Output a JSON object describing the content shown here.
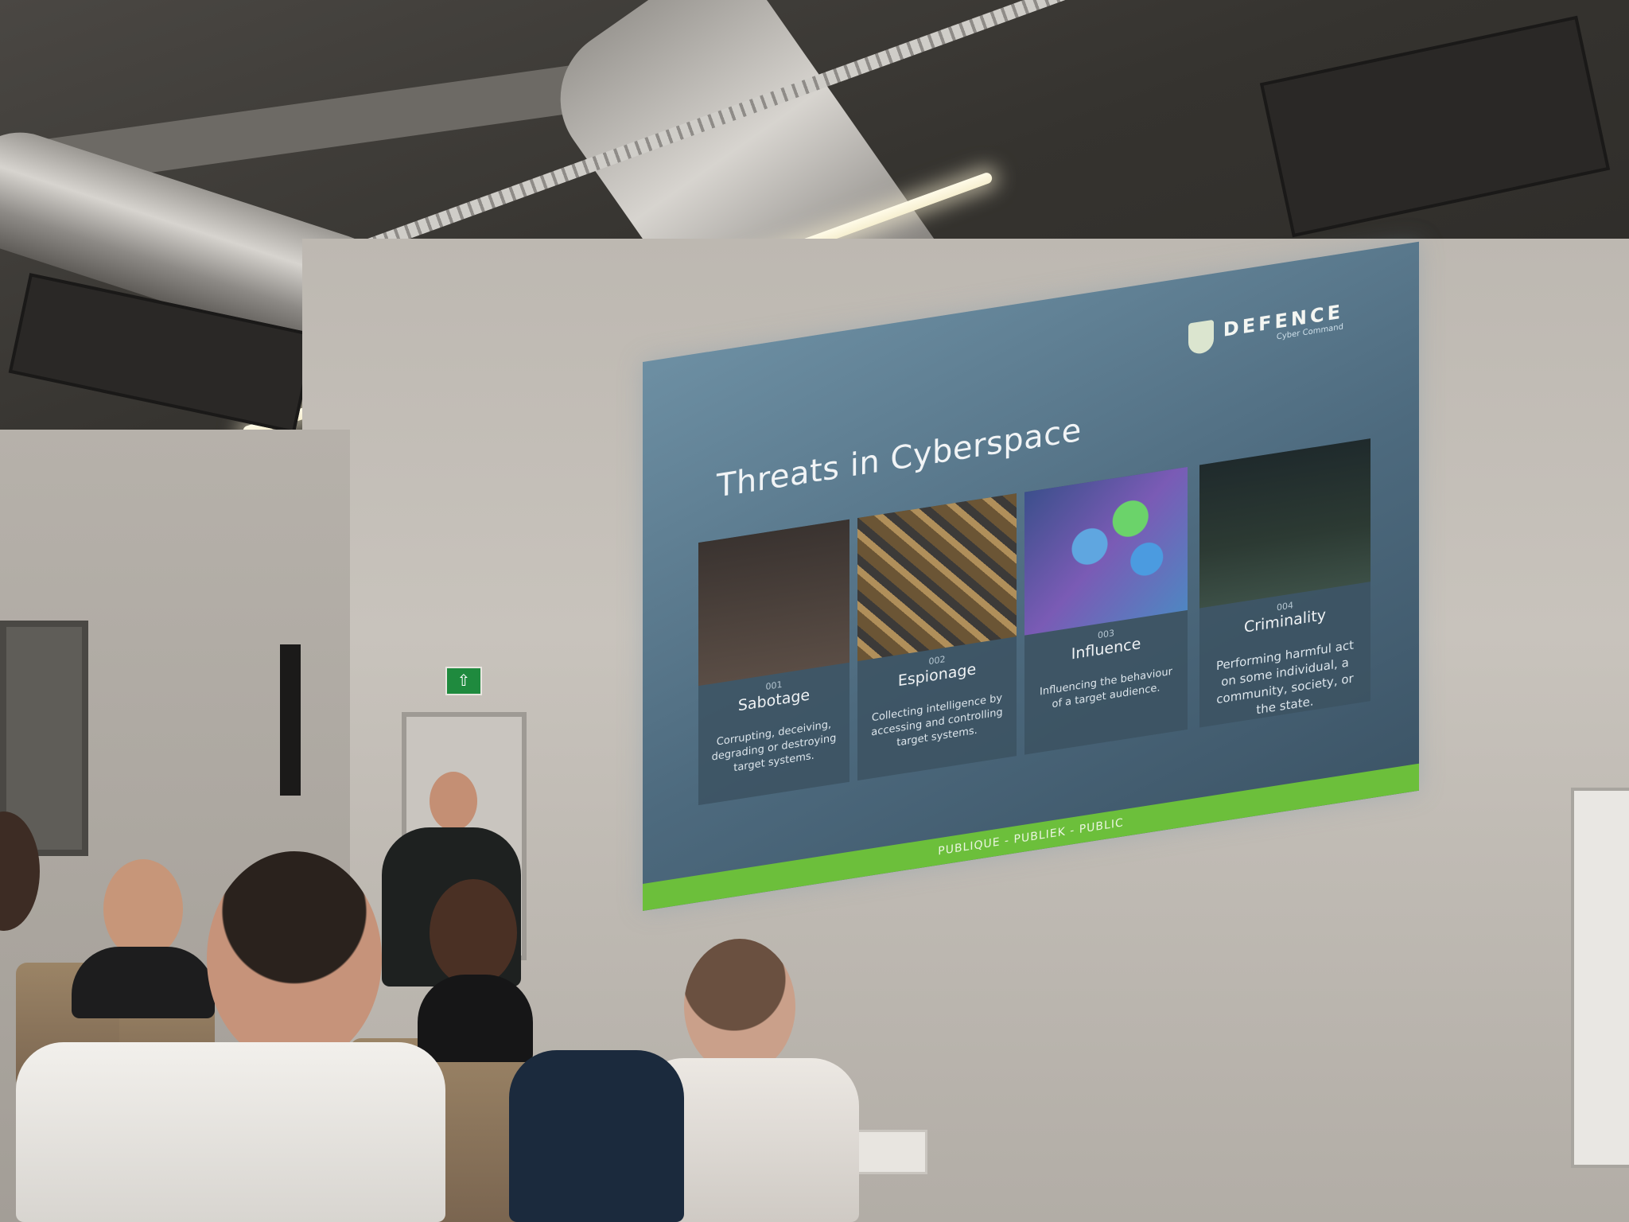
{
  "slide": {
    "title": "Threats in Cyberspace",
    "logo": {
      "name": "DEFENCE",
      "subtitle": "Cyber Command"
    },
    "cards": [
      {
        "number": "001",
        "title": "Sabotage",
        "description": "Corrupting, deceiving, degrading or destroying target systems."
      },
      {
        "number": "002",
        "title": "Espionage",
        "description": "Collecting intelligence by accessing and controlling target systems."
      },
      {
        "number": "003",
        "title": "Influence",
        "description": "Influencing the behaviour of a target audience."
      },
      {
        "number": "004",
        "title": "Criminality",
        "description": "Performing harmful act on some individual, a community, society, or the state."
      }
    ],
    "footer": "PUBLIQUE - PUBLIEK - PUBLIC"
  },
  "colors": {
    "slide_background": "#4d6a7e",
    "footer_green": "#6cbf3b",
    "exit_sign_green": "#1f8a3e"
  },
  "icons": {
    "exit_sign": "running-man-arrow-icon",
    "logo": "shield-icon"
  }
}
